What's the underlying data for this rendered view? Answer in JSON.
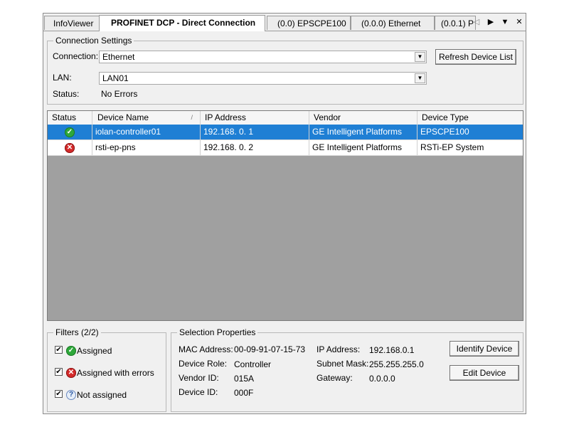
{
  "tabs": [
    {
      "label": "InfoViewer",
      "active": false
    },
    {
      "label": "PROFINET   DCP - Direct Connection",
      "active": true
    },
    {
      "label": "(0.0) EPSCPE100",
      "active": false
    },
    {
      "label": "(0.0.0) Ethernet",
      "active": false
    },
    {
      "label": "(0.0.1) P",
      "active": false
    }
  ],
  "tab_controls": {
    "left": "◁",
    "right": "▶",
    "menu": "▼",
    "close": "✕"
  },
  "connection_settings": {
    "title": "Connection Settings",
    "connection_label": "Connection:",
    "connection_value": "Ethernet",
    "lan_label": "LAN:",
    "lan_value": "LAN01",
    "status_label": "Status:",
    "status_value": "No Errors",
    "refresh_button": "Refresh Device List"
  },
  "grid": {
    "columns": [
      "Status",
      "Device Name",
      "IP Address",
      "Vendor",
      "Device Type"
    ],
    "sort_indicator": "/",
    "rows": [
      {
        "status": "ok",
        "status_glyph": "✓",
        "name": "iolan-controller01",
        "ip": "192.168.  0.  1",
        "vendor": "GE Intelligent Platforms",
        "type": "EPSCPE100",
        "selected": true
      },
      {
        "status": "error",
        "status_glyph": "✕",
        "name": "rsti-ep-pns",
        "ip": "192.168.  0.  2",
        "vendor": "GE Intelligent Platforms",
        "type": "RSTi-EP System",
        "selected": false
      }
    ]
  },
  "filters": {
    "title": "Filters  (2/2)",
    "items": [
      {
        "label": "Assigned",
        "checked": true,
        "icon": "ok-icon",
        "glyph": "✓"
      },
      {
        "label": "Assigned with errors",
        "checked": true,
        "icon": "error-icon",
        "glyph": "✕"
      },
      {
        "label": "Not assigned",
        "checked": true,
        "icon": "question-icon",
        "glyph": "?"
      }
    ],
    "check_glyph": "✔"
  },
  "selection": {
    "title": "Selection Properties",
    "mac_label": "MAC Address:",
    "mac_value": "00-09-91-07-15-73",
    "role_label": "Device Role:",
    "role_value": "Controller",
    "vendor_label": "Vendor ID:",
    "vendor_value": "015A",
    "device_label": "Device ID:",
    "device_value": "000F",
    "ip_label": "IP Address:",
    "ip_value": "192.168.0.1",
    "mask_label": "Subnet Mask:",
    "mask_value": "255.255.255.0",
    "gw_label": "Gateway:",
    "gw_value": "0.0.0.0",
    "identify_button": "Identify Device",
    "edit_button": "Edit Device"
  },
  "colors": {
    "selection": "#1f7fd4",
    "grid_background": "#a0a0a0",
    "ok": "#2ea83a",
    "error": "#d42a2a"
  }
}
